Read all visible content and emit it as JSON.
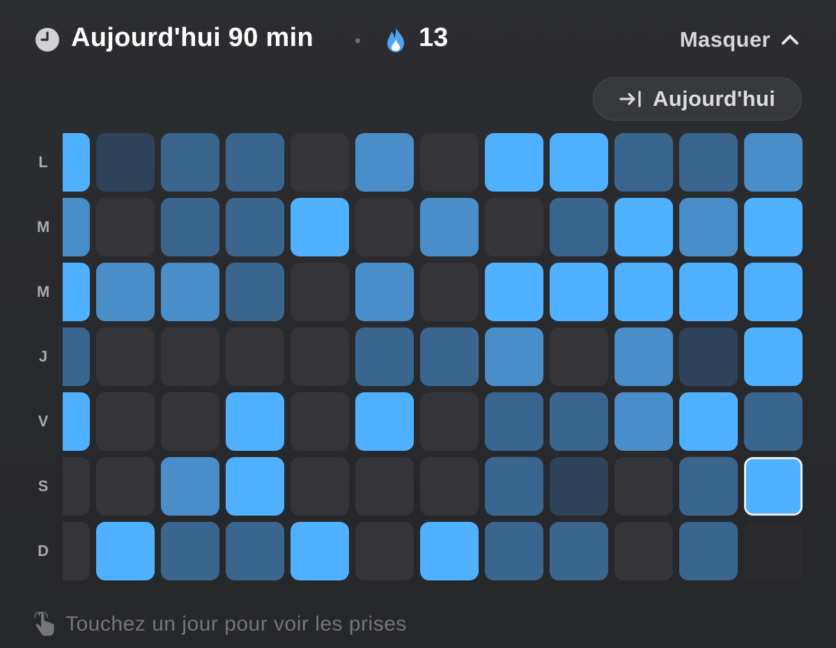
{
  "header": {
    "title": "Aujourd'hui 90 min",
    "streak": "13",
    "toggle_label": "Masquer",
    "clock_icon": "clock-icon",
    "flame_icon": "flame-icon",
    "chevron_icon": "chevron-up-icon"
  },
  "today_button": {
    "label": "Aujourd'hui",
    "icon": "jump-to-today-icon"
  },
  "days": [
    "L",
    "M",
    "M",
    "J",
    "V",
    "S",
    "D"
  ],
  "levels": {
    "0": "#353539",
    "1": "#2e4259",
    "2": "#3a658f",
    "3": "#4a8ec9",
    "4": "#4fb1ff",
    "empty": "#2b2b2e"
  },
  "grid": [
    [
      4,
      1,
      2,
      2,
      0,
      3,
      0,
      4,
      4,
      2,
      2,
      3
    ],
    [
      3,
      0,
      2,
      2,
      4,
      0,
      3,
      0,
      2,
      4,
      3,
      4
    ],
    [
      4,
      3,
      3,
      2,
      0,
      3,
      0,
      4,
      4,
      4,
      4,
      4
    ],
    [
      2,
      0,
      0,
      0,
      0,
      2,
      2,
      3,
      0,
      3,
      1,
      4
    ],
    [
      4,
      0,
      0,
      4,
      0,
      4,
      0,
      2,
      2,
      3,
      4,
      2
    ],
    [
      0,
      0,
      3,
      4,
      0,
      0,
      0,
      2,
      1,
      0,
      2,
      4
    ],
    [
      0,
      4,
      2,
      2,
      4,
      0,
      4,
      2,
      2,
      0,
      2,
      -1
    ]
  ],
  "selected_cell": {
    "row": 5,
    "col": 11
  },
  "hint": {
    "label": "Touchez un jour pour voir les prises",
    "icon": "tap-hand-icon"
  }
}
